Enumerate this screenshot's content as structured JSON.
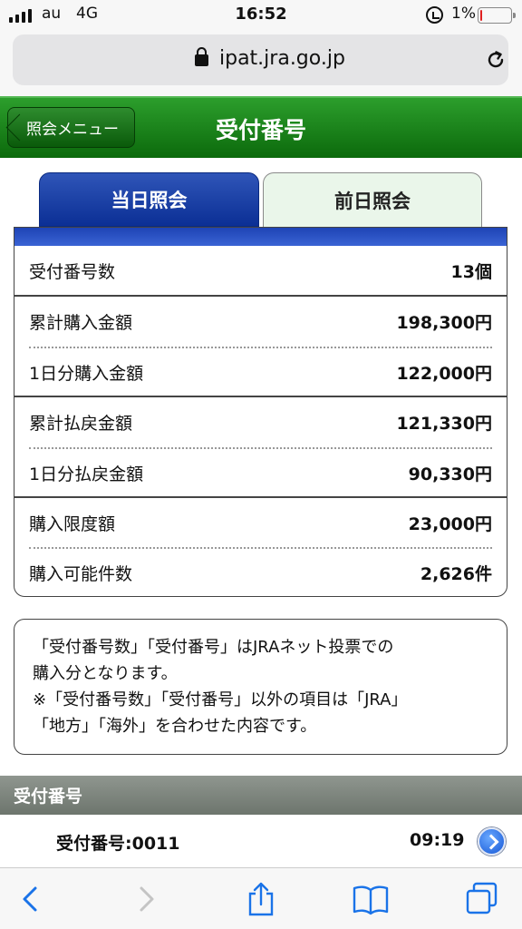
{
  "status": {
    "carrier": "au",
    "network": "4G",
    "time": "16:52",
    "battery": "1%",
    "battery_level": 0.01
  },
  "browser": {
    "url": "ipat.jra.go.jp"
  },
  "header": {
    "back_label": "照会メニュー",
    "title": "受付番号"
  },
  "tabs": [
    {
      "label": "当日照会",
      "active": true
    },
    {
      "label": "前日照会",
      "active": false
    }
  ],
  "summary": [
    {
      "label": "受付番号数",
      "value": "13個"
    },
    {
      "label": "累計購入金額",
      "value": "198,300円"
    },
    {
      "label": "1日分購入金額",
      "value": "122,000円"
    },
    {
      "label": "累計払戻金額",
      "value": "121,330円"
    },
    {
      "label": "1日分払戻金額",
      "value": "90,330円"
    },
    {
      "label": "購入限度額",
      "value": "23,000円"
    },
    {
      "label": "購入可能件数",
      "value": "2,626件"
    }
  ],
  "note": [
    "「受付番号数」「受付番号」はJRAネット投票での",
    "購入分となります。",
    "※「受付番号数」「受付番号」以外の項目は「JRA」",
    "「地方」「海外」を合わせた内容です。"
  ],
  "section_title": "受付番号",
  "entries": [
    {
      "label": "受付番号:0011",
      "time": "09:19"
    }
  ],
  "icons": {
    "back": "chevron-left-icon",
    "forward": "chevron-right-icon",
    "share": "share-icon",
    "bookmarks": "book-icon",
    "tabs": "tabs-icon",
    "reload": "reload-icon",
    "lock": "lock-icon"
  }
}
